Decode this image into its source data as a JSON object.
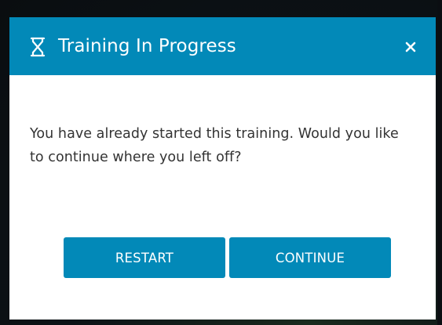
{
  "modal": {
    "title": "Training In Progress",
    "title_icon": "hourglass-icon",
    "close_icon": "close-icon",
    "message": "You have already started this training. Would you like to continue where you left off?",
    "buttons": {
      "restart_label": "RESTART",
      "continue_label": "CONTINUE"
    }
  },
  "colors": {
    "accent": "#0289b8",
    "text": "#333333",
    "backdrop": "#0c1216"
  }
}
